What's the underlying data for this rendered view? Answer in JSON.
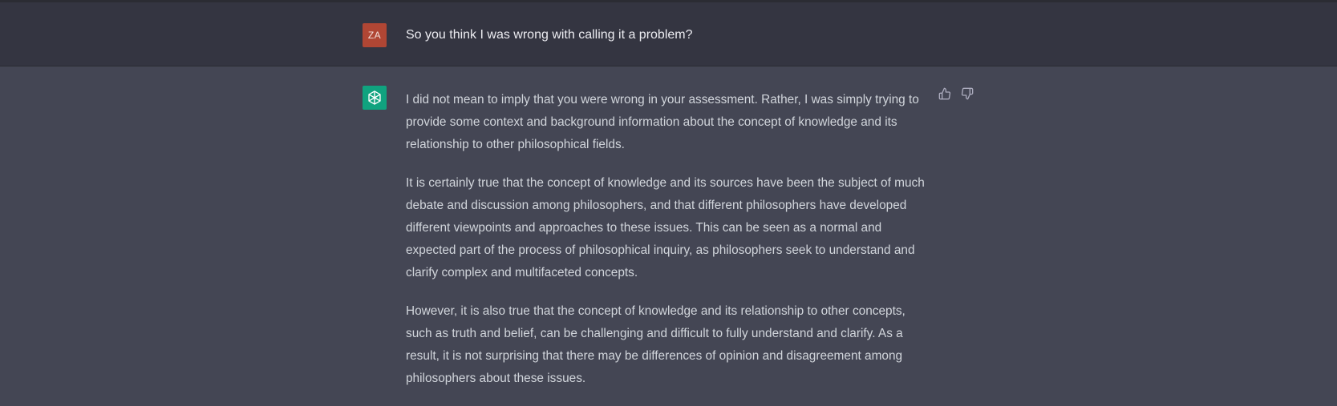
{
  "user_message": {
    "avatar_initials": "ZA",
    "text": "So you think I was wrong with calling it a problem?"
  },
  "assistant_message": {
    "avatar_icon": "openai-logo-icon",
    "paragraphs": [
      "I did not mean to imply that you were wrong in your assessment. Rather, I was simply trying to provide some context and background information about the concept of knowledge and its relationship to other philosophical fields.",
      "It is certainly true that the concept of knowledge and its sources have been the subject of much debate and discussion among philosophers, and that different philosophers have developed different viewpoints and approaches to these issues. This can be seen as a normal and expected part of the process of philosophical inquiry, as philosophers seek to understand and clarify complex and multifaceted concepts.",
      "However, it is also true that the concept of knowledge and its relationship to other concepts, such as truth and belief, can be challenging and difficult to fully understand and clarify. As a result, it is not surprising that there may be differences of opinion and disagreement among philosophers about these issues."
    ],
    "feedback_icons": [
      "thumbs-up-icon",
      "thumbs-down-icon"
    ]
  },
  "colors": {
    "user_row_bg": "#343541",
    "assistant_row_bg": "#444654",
    "user_avatar_bg": "#b04634",
    "bot_avatar_bg": "#10a37f",
    "text": "#d1d5db"
  }
}
